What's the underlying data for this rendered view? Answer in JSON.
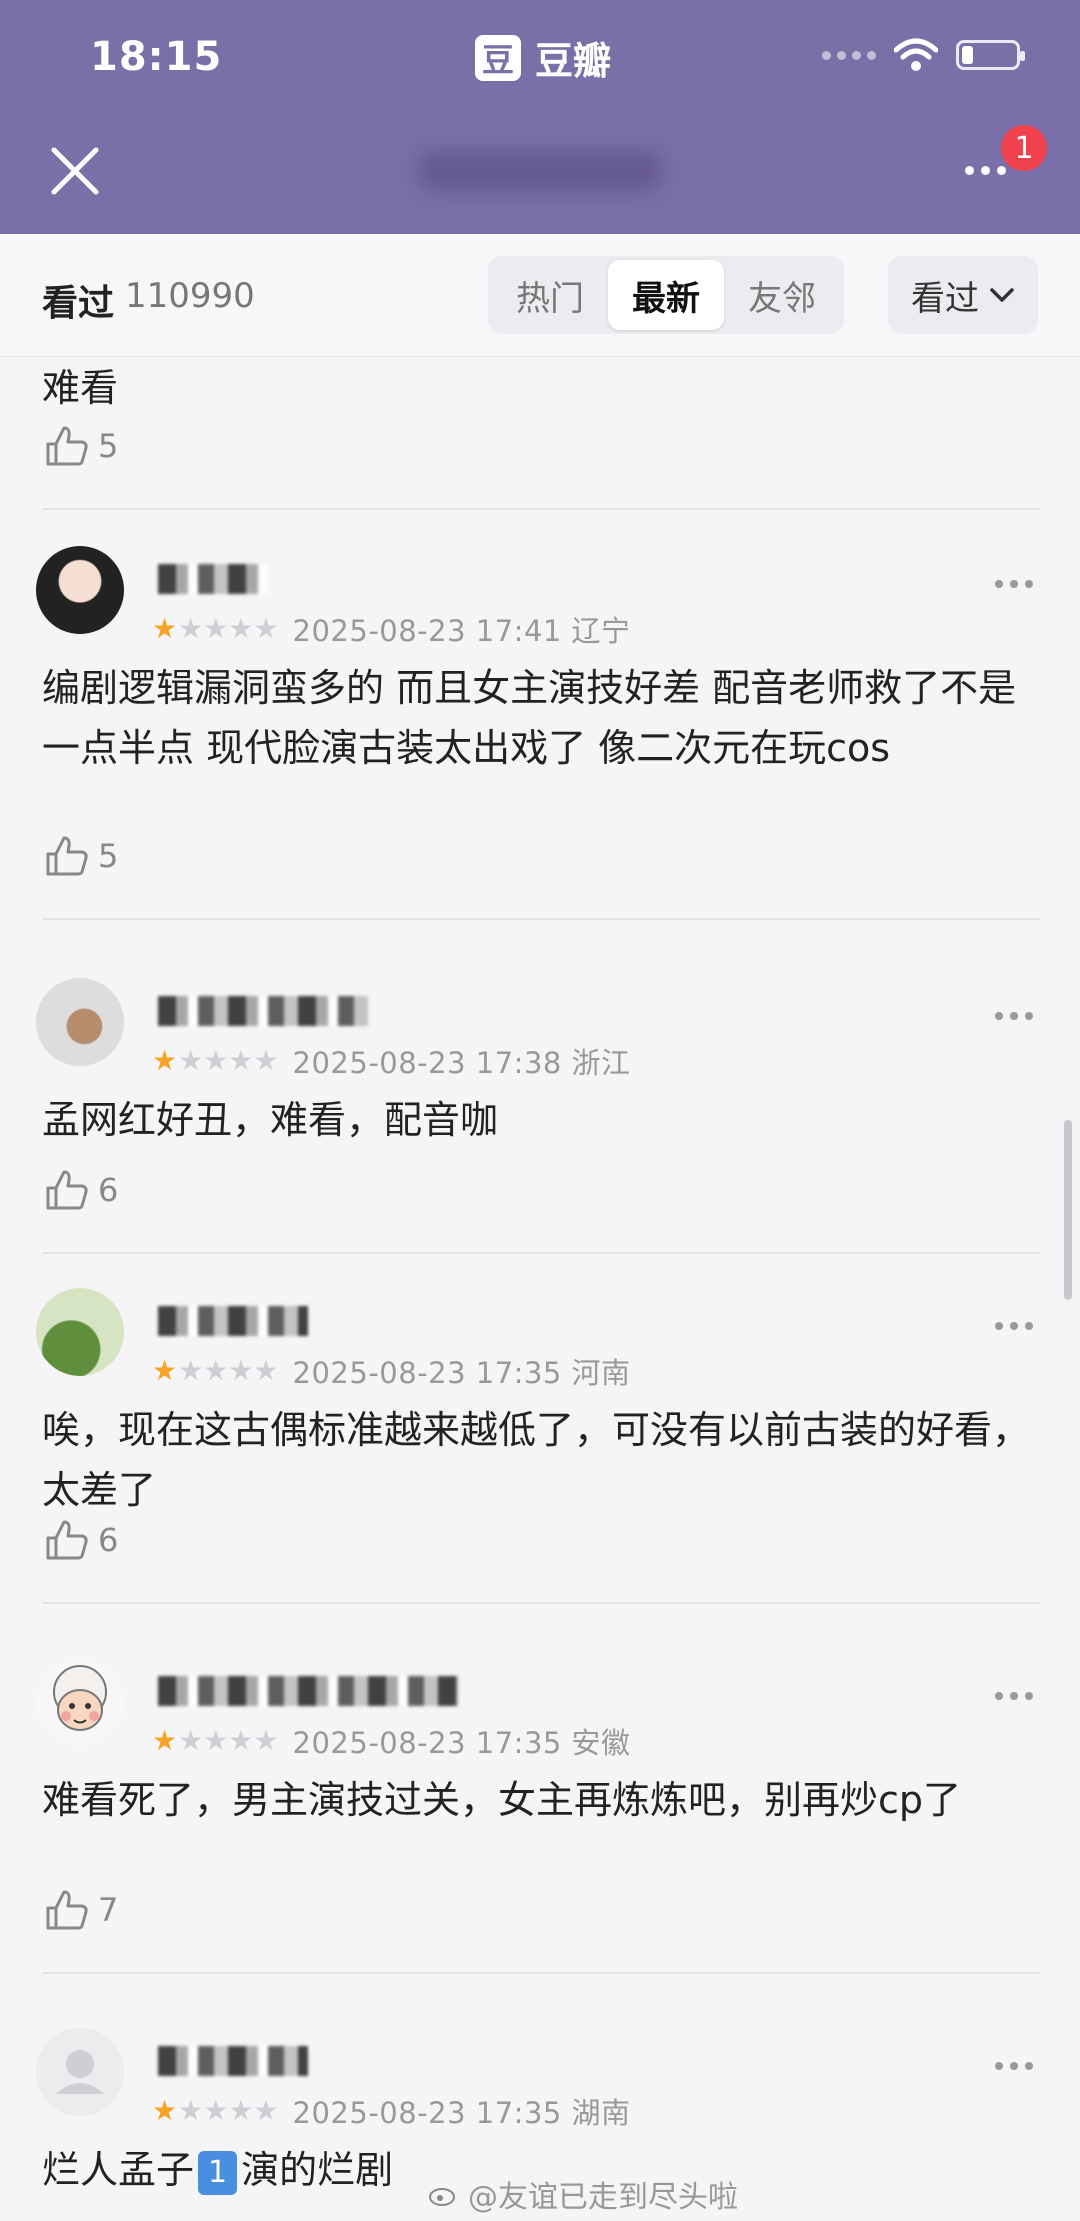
{
  "status": {
    "time": "18:15",
    "app_name": "豆瓣",
    "app_logo_char": "豆",
    "battery_fraction": 0.22
  },
  "header": {
    "notification_count": "1"
  },
  "filter": {
    "seen_label": "看过",
    "seen_count": "110990",
    "tabs": [
      {
        "label": "热门"
      },
      {
        "label": "最新"
      },
      {
        "label": "友邻"
      }
    ],
    "active_tab": "最新",
    "sort_label": "看过"
  },
  "comments": [
    {
      "text": "难看",
      "likes": "5"
    },
    {
      "meta": "2025-08-23 17:41 辽宁",
      "stars": 1,
      "text": "编剧逻辑漏洞蛮多的 而且女主演技好差 配音老师救了不是一点半点  现代脸演古装太出戏了 像二次元在玩cos",
      "likes": "5"
    },
    {
      "meta": "2025-08-23 17:38 浙江",
      "stars": 1,
      "text": "孟网红好丑，难看，配音咖",
      "likes": "6"
    },
    {
      "meta": "2025-08-23 17:35 河南",
      "stars": 1,
      "text": "唉，现在这古偶标准越来越低了，可没有以前古装的好看，太差了",
      "likes": "6"
    },
    {
      "meta": "2025-08-23 17:35 安徽",
      "stars": 1,
      "text": "难看死了，男主演技过关，女主再炼炼吧，别再炒cp了",
      "likes": "7"
    },
    {
      "meta": "2025-08-23 17:35 湖南",
      "stars": 1,
      "text_before": "烂人孟子",
      "text_num": "1",
      "text_after": "演的烂剧"
    }
  ],
  "watermark": "@友谊已走到尽头啦",
  "colors": {
    "header": "#7a6fa7",
    "star": "#f7a325",
    "badge": "#f0424e"
  }
}
